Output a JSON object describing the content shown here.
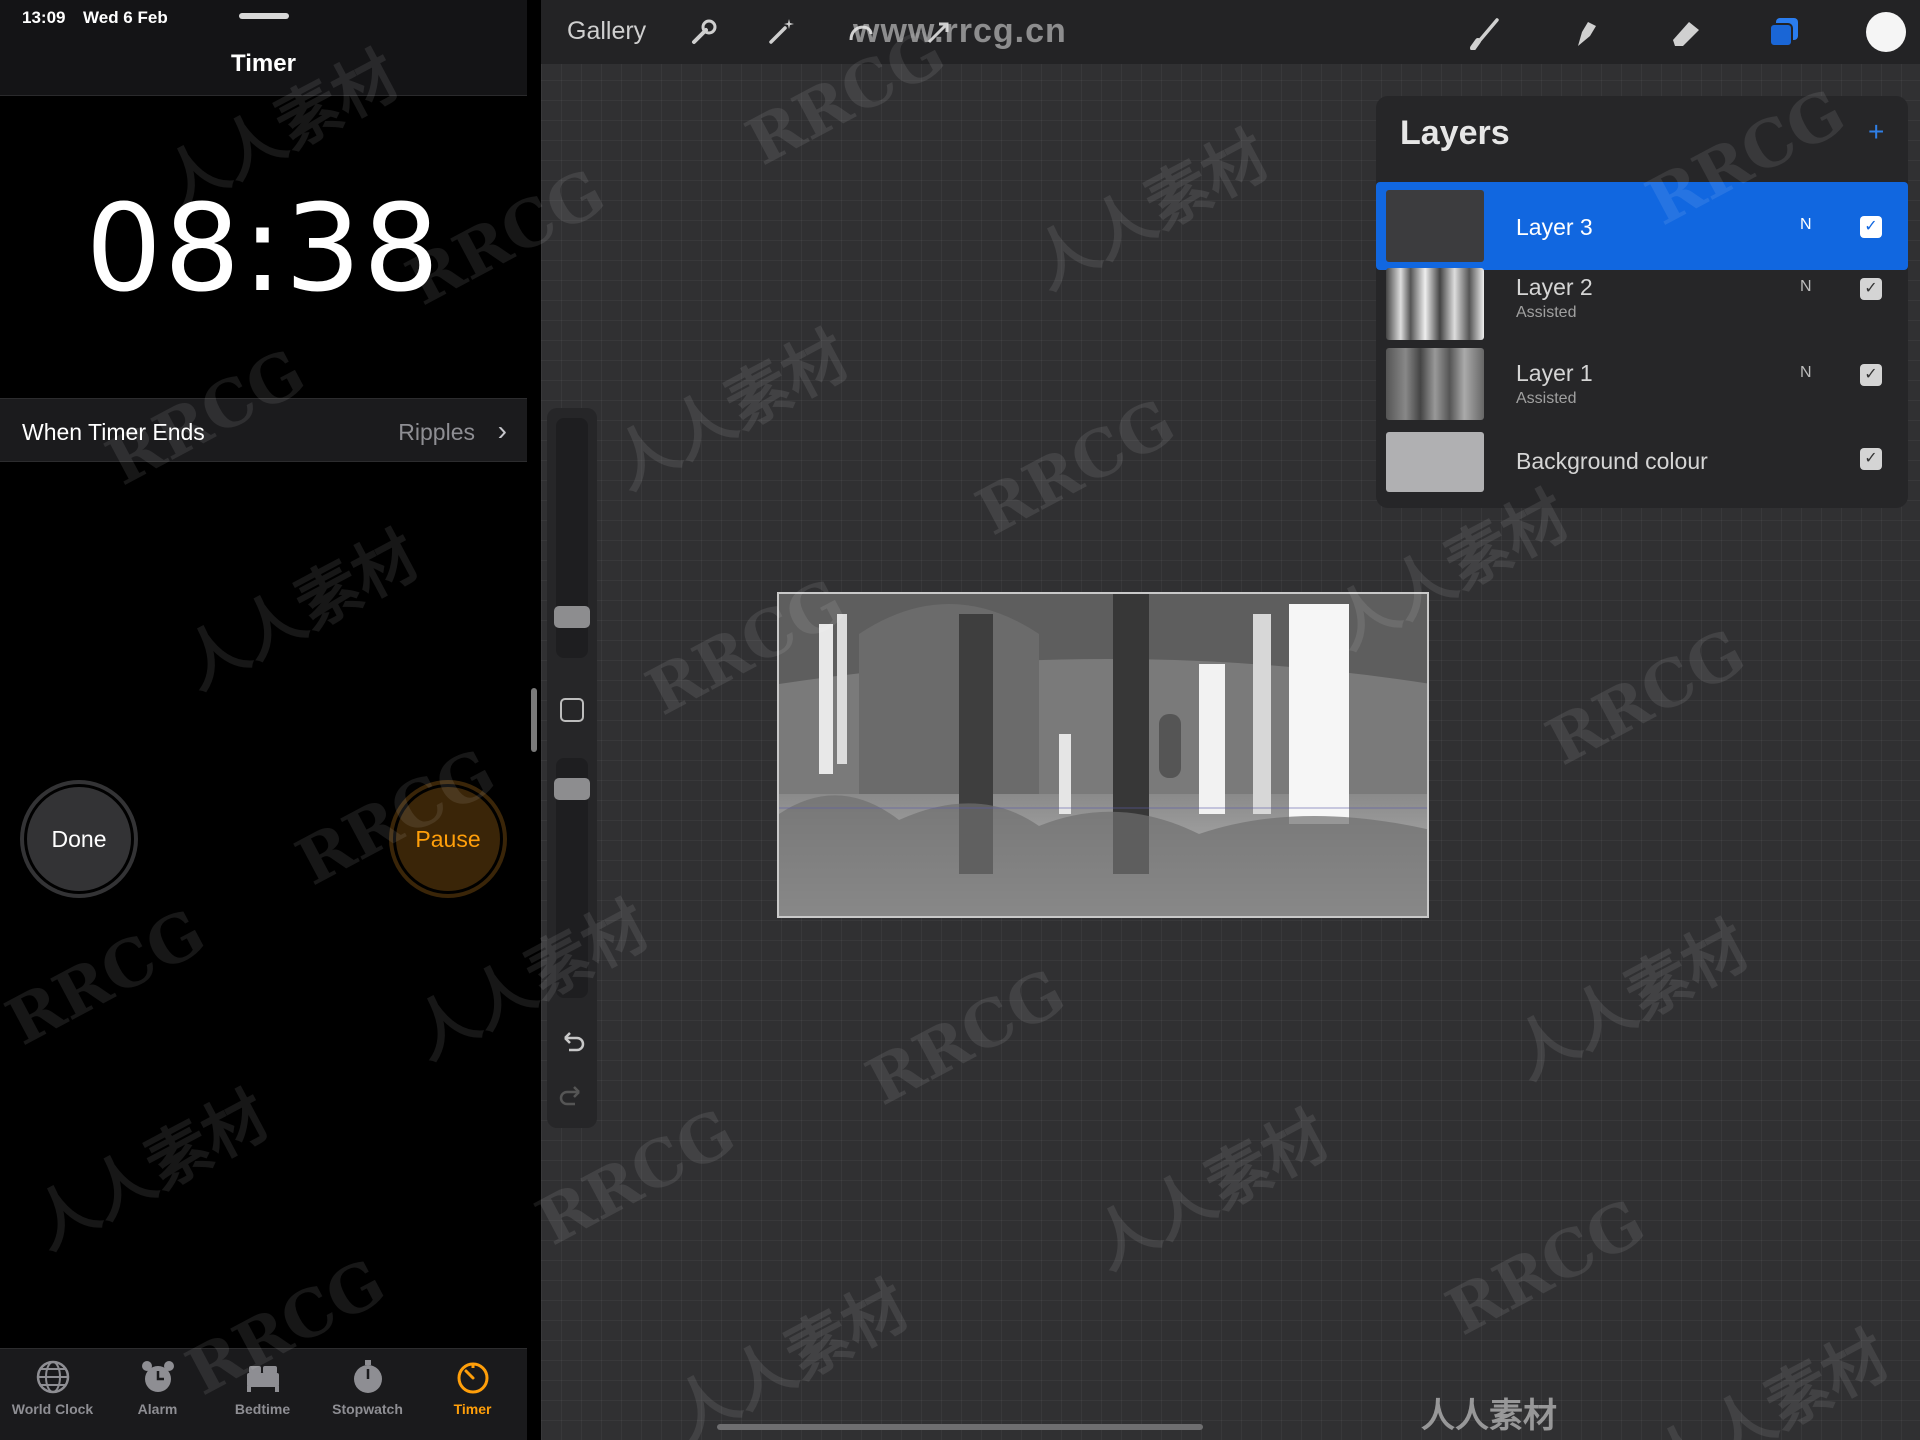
{
  "clock_app": {
    "status_bar": {
      "time": "13:09",
      "date": "Wed 6 Feb"
    },
    "title": "Timer",
    "countdown": "08:38",
    "when_timer_ends": {
      "label": "When Timer Ends",
      "value": "Ripples"
    },
    "buttons": {
      "done": "Done",
      "pause": "Pause"
    },
    "tabs": [
      {
        "label": "World Clock",
        "icon": "globe-icon"
      },
      {
        "label": "Alarm",
        "icon": "alarm-clock-icon"
      },
      {
        "label": "Bedtime",
        "icon": "bed-icon"
      },
      {
        "label": "Stopwatch",
        "icon": "stopwatch-icon"
      },
      {
        "label": "Timer",
        "icon": "timer-icon",
        "active": true
      }
    ],
    "accent_color": "#ff9f0a"
  },
  "procreate": {
    "top_bar": {
      "gallery": "Gallery",
      "left_tools": [
        "wrench-icon",
        "magic-wand-icon",
        "selection-icon",
        "transform-arrow-icon"
      ],
      "right_tools": [
        "brush-icon",
        "smudge-icon",
        "eraser-icon",
        "layers-icon",
        "color-swatch"
      ],
      "website": "www.rrcg.cn"
    },
    "layers_panel": {
      "title": "Layers",
      "layers": [
        {
          "name": "Layer 3",
          "blend": "N",
          "visible": true,
          "selected": true,
          "sub": ""
        },
        {
          "name": "Layer 2",
          "blend": "N",
          "visible": true,
          "selected": false,
          "sub": "Assisted"
        },
        {
          "name": "Layer 1",
          "blend": "N",
          "visible": true,
          "selected": false,
          "sub": "Assisted"
        },
        {
          "name": "Background colour",
          "blend": "",
          "visible": true,
          "selected": false,
          "sub": ""
        }
      ],
      "selected_color": "#1167e0"
    },
    "watermark": {
      "latin": "RRCG",
      "cjk": "人人素材",
      "bottom": "人人素材"
    }
  }
}
